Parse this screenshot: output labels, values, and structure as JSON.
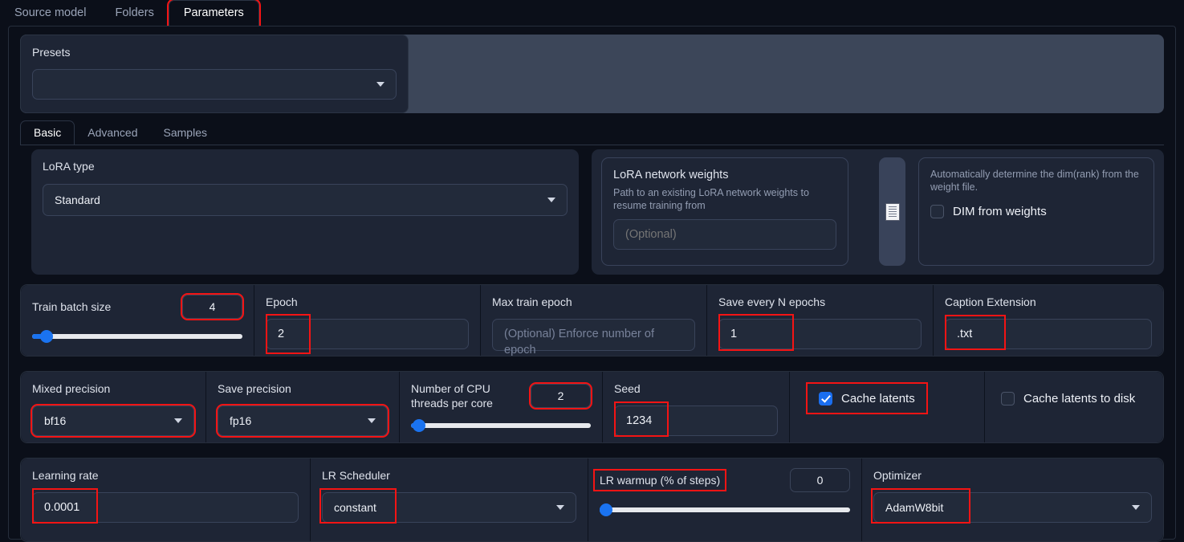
{
  "top_tabs": [
    {
      "label": "Source model",
      "active": false,
      "highlighted": false
    },
    {
      "label": "Folders",
      "active": false,
      "highlighted": false
    },
    {
      "label": "Parameters",
      "active": true,
      "highlighted": true
    }
  ],
  "presets": {
    "label": "Presets",
    "value": "",
    "caret_icon": "chevron-down-icon"
  },
  "sub_tabs": [
    {
      "label": "Basic",
      "active": true
    },
    {
      "label": "Advanced",
      "active": false
    },
    {
      "label": "Samples",
      "active": false
    }
  ],
  "lora_type": {
    "label": "LoRA type",
    "value": "Standard",
    "caret_icon": "chevron-down-icon"
  },
  "lora_network_weights": {
    "label": "LoRA network weights",
    "description": "Path to an existing LoRA network weights to resume training from",
    "placeholder": "(Optional)",
    "value": "",
    "file_button_icon": "document-icon"
  },
  "dim_from_weights": {
    "description": "Automatically determine the dim(rank) from the weight file.",
    "label": "DIM from weights",
    "checked": false
  },
  "train_batch_size": {
    "label": "Train batch size",
    "value": "4",
    "slider_percent": 8,
    "highlighted": true
  },
  "epoch": {
    "label": "Epoch",
    "value": "2",
    "highlighted": true
  },
  "max_train_epoch": {
    "label": "Max train epoch",
    "placeholder": "(Optional) Enforce number of epoch",
    "value": ""
  },
  "save_every_n_epochs": {
    "label": "Save every N epochs",
    "value": "1",
    "highlighted": true
  },
  "caption_extension": {
    "label": "Caption Extension",
    "value": ".txt",
    "highlighted": true
  },
  "mixed_precision": {
    "label": "Mixed precision",
    "value": "bf16",
    "highlighted": true,
    "caret_icon": "chevron-down-icon"
  },
  "save_precision": {
    "label": "Save precision",
    "value": "fp16",
    "highlighted": true,
    "caret_icon": "chevron-down-icon"
  },
  "cpu_threads": {
    "label": "Number of CPU threads per core",
    "value": "2",
    "slider_percent": 5,
    "highlighted": true
  },
  "seed": {
    "label": "Seed",
    "value": "1234",
    "highlighted": true
  },
  "cache_latents": {
    "label": "Cache latents",
    "checked": true,
    "highlighted": true
  },
  "cache_latents_to_disk": {
    "label": "Cache latents to disk",
    "checked": false,
    "highlighted": false
  },
  "learning_rate": {
    "label": "Learning rate",
    "value": "0.0001",
    "highlighted": true
  },
  "lr_scheduler": {
    "label": "LR Scheduler",
    "value": "constant",
    "highlighted": true,
    "caret_icon": "chevron-down-icon"
  },
  "lr_warmup": {
    "label": "LR warmup (% of steps)",
    "value": "0",
    "slider_percent": 1,
    "highlighted": true
  },
  "optimizer": {
    "label": "Optimizer",
    "value": "AdamW8bit",
    "highlighted": true,
    "caret_icon": "chevron-down-icon"
  },
  "colors": {
    "highlight": "#f41414",
    "accent": "#1a73f0",
    "panel": "#1e2535",
    "background": "#0b0f19"
  }
}
